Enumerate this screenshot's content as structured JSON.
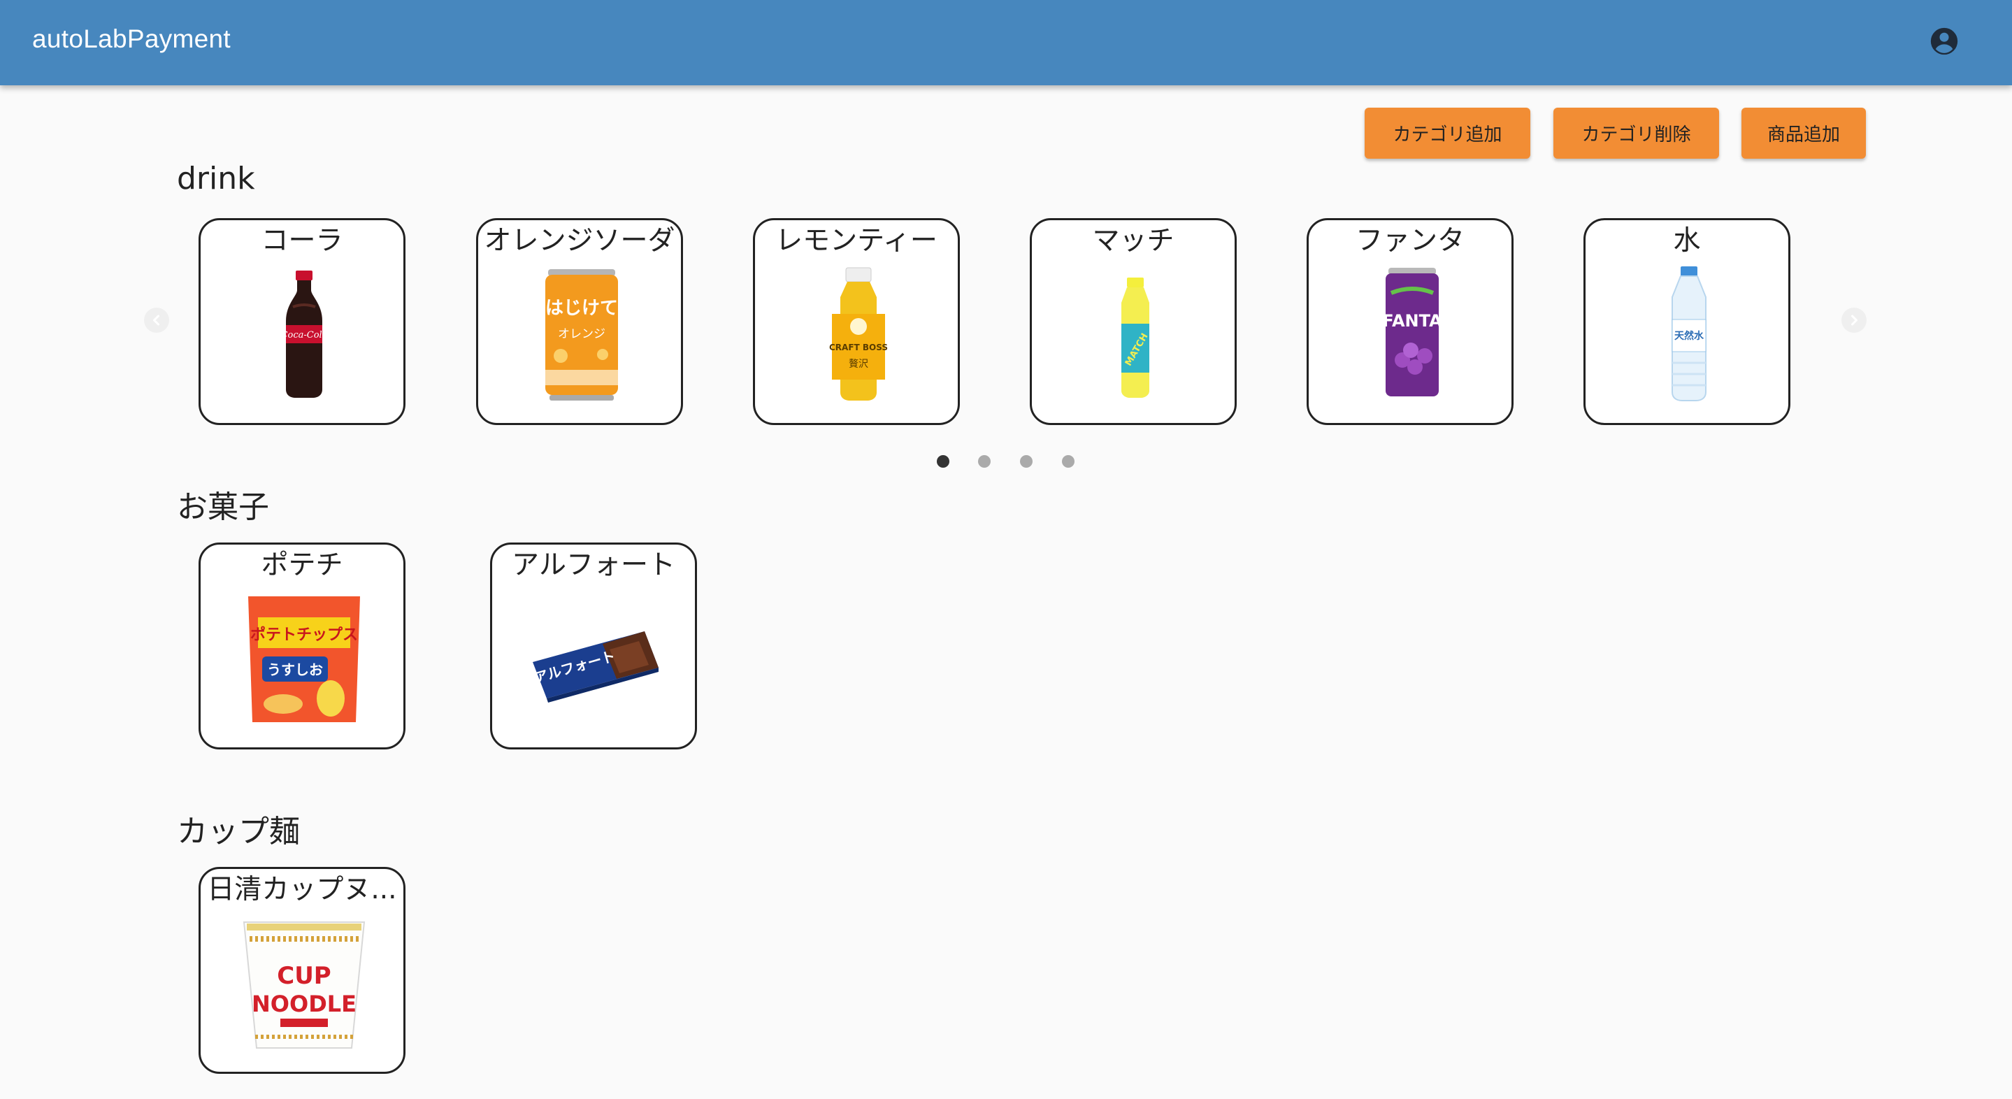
{
  "app": {
    "title": "autoLabPayment",
    "account_icon": "account-circle-icon"
  },
  "toolbar": {
    "add_category": "カテゴリ追加",
    "delete_category": "カテゴリ削除",
    "add_product": "商品追加",
    "button_color": "#f28d34"
  },
  "colors": {
    "appbar": "#4787be",
    "background": "#fafafa",
    "card_border": "#222222"
  },
  "categories": [
    {
      "name": "drink",
      "products": [
        {
          "name": "コーラ",
          "image": "cola-bottle"
        },
        {
          "name": "オレンジソーダ",
          "image": "orange-soda-can"
        },
        {
          "name": "レモンティー",
          "image": "lemon-tea-bottle"
        },
        {
          "name": "マッチ",
          "image": "match-bottle"
        },
        {
          "name": "ファンタ",
          "image": "fanta-grape-can"
        },
        {
          "name": "水",
          "image": "water-bottle"
        }
      ],
      "carousel": {
        "pages": 4,
        "current_page": 1,
        "prev_icon": "chevron-left-icon",
        "next_icon": "chevron-right-icon"
      }
    },
    {
      "name": "お菓子",
      "products": [
        {
          "name": "ポテチ",
          "image": "potato-chips-bag"
        },
        {
          "name": "アルフォート",
          "image": "alfort-chocolate-box"
        }
      ]
    },
    {
      "name": "カップ麺",
      "products": [
        {
          "name": "日清カップヌ...",
          "image": "cup-noodle"
        }
      ]
    }
  ]
}
